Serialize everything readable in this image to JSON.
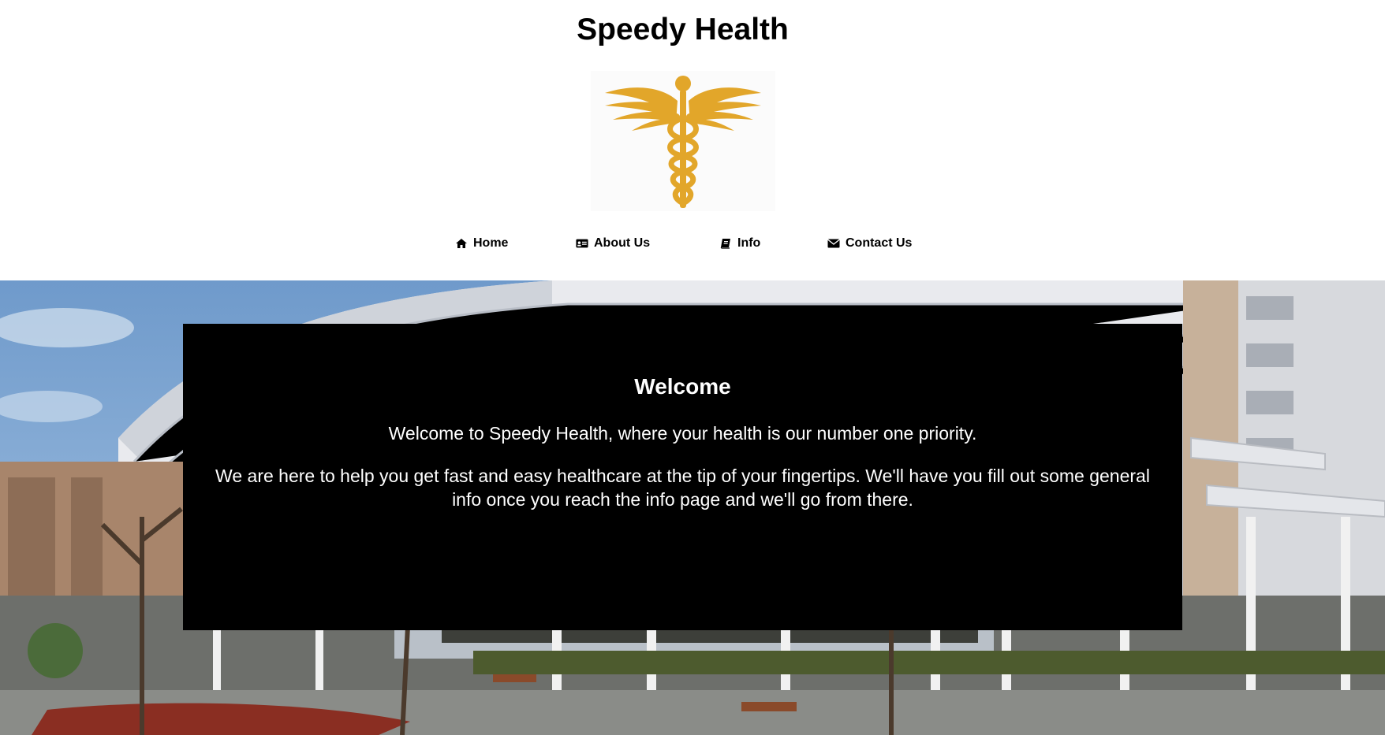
{
  "header": {
    "title": "Speedy Health",
    "logo_icon": "caduceus-icon",
    "logo_color": "#e2a62a"
  },
  "nav": {
    "items": [
      {
        "label": "Home",
        "icon": "home-icon"
      },
      {
        "label": "About Us",
        "icon": "id-card-icon"
      },
      {
        "label": "Info",
        "icon": "book-icon"
      },
      {
        "label": "Contact Us",
        "icon": "envelope-icon"
      }
    ]
  },
  "welcome": {
    "title": "Welcome",
    "paragraph1": "Welcome to Speedy Health, where your health is our number one priority.",
    "paragraph2": "We are here to help you get fast and easy healthcare at the tip of your fingertips. We'll have you fill out some general info once you reach the info page and we'll go from there.",
    "background": "#000000",
    "text_color": "#ffffff"
  }
}
